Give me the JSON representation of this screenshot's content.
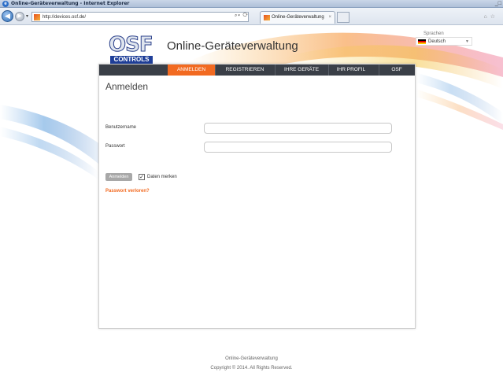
{
  "window": {
    "title": "Online-Geräteverwaltung - Internet Explorer"
  },
  "browser": {
    "url": "http://devices.osf.de/",
    "tab_label": "Online-Geräteverwaltung",
    "tab_close": "×"
  },
  "header": {
    "logo_text": "OSF",
    "logo_sub": "CONTROLS",
    "site_title": "Online-Geräteverwaltung",
    "language_label": "Sprachen",
    "language_value": "Deutsch"
  },
  "nav": {
    "items": [
      {
        "label": "ANMELDEN",
        "active": true
      },
      {
        "label": "REGISTRIEREN",
        "active": false
      },
      {
        "label": "IHRE GERÄTE",
        "active": false
      },
      {
        "label": "IHR PROFIL",
        "active": false
      },
      {
        "label": "OSF",
        "active": false
      }
    ]
  },
  "login": {
    "heading": "Anmelden",
    "username_label": "Benutzername",
    "username_value": "",
    "password_label": "Passwort",
    "password_value": "",
    "submit_label": "Anmelden",
    "remember_checked": true,
    "remember_label": "Daten merken",
    "forgot_label": "Passwort verloren?"
  },
  "footer": {
    "line1": "Online-Geräteverwaltung",
    "line2": "Copyright © 2014. All Rights Reserved."
  },
  "colors": {
    "accent": "#f26a21",
    "navbar": "#3a3f47",
    "logo_blue": "#1f3f99"
  }
}
